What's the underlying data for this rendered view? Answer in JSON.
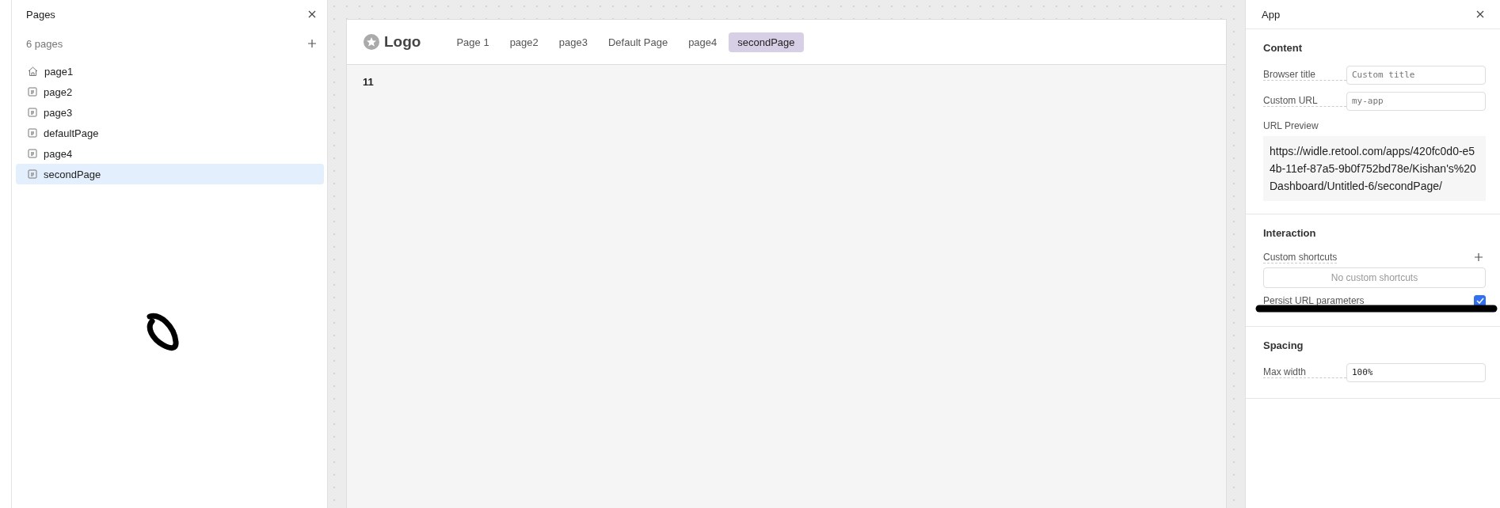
{
  "pages_panel": {
    "title": "Pages",
    "count": "6 pages",
    "items": [
      {
        "label": "page1",
        "kind": "home",
        "selected": false
      },
      {
        "label": "page2",
        "kind": "page",
        "selected": false
      },
      {
        "label": "page3",
        "kind": "page",
        "selected": false
      },
      {
        "label": "defaultPage",
        "kind": "page",
        "selected": false
      },
      {
        "label": "page4",
        "kind": "page",
        "selected": false
      },
      {
        "label": "secondPage",
        "kind": "page",
        "selected": true
      }
    ]
  },
  "app_preview": {
    "logo": "Logo",
    "nav": [
      {
        "label": "Page 1",
        "selected": false
      },
      {
        "label": "page2",
        "selected": false
      },
      {
        "label": "page3",
        "selected": false
      },
      {
        "label": "Default Page",
        "selected": false
      },
      {
        "label": "page4",
        "selected": false
      },
      {
        "label": "secondPage",
        "selected": true
      }
    ],
    "body_text": "11"
  },
  "inspector": {
    "title": "App",
    "sections": [
      {
        "title": "Content",
        "rows": [
          {
            "kind": "input",
            "label": "Browser title",
            "placeholder": "Custom title"
          },
          {
            "kind": "input",
            "label": "Custom URL",
            "placeholder": "my-app"
          },
          {
            "kind": "preview",
            "label": "URL Preview",
            "value": "https://widle.retool.com/apps/420fc0d0-e54b-11ef-87a5-9b0f752bd78e/Kishan's%20Dashboard/Untitled-6/secondPage/"
          }
        ]
      },
      {
        "title": "Interaction",
        "rows": [
          {
            "kind": "list",
            "label": "Custom shortcuts",
            "empty": "No custom shortcuts"
          },
          {
            "kind": "checkbox",
            "label": "Persist URL parameters",
            "checked": true
          }
        ]
      },
      {
        "title": "Spacing",
        "rows": [
          {
            "kind": "input",
            "label": "Max width",
            "value": "100%"
          }
        ]
      }
    ]
  },
  "ink_marks": {
    "loop_on_pages": true,
    "stroke_on_inspector": true
  }
}
